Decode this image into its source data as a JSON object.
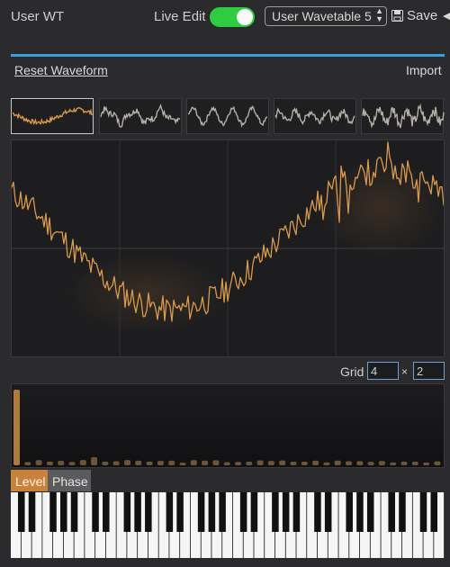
{
  "header": {
    "title": "User WT",
    "live_edit_label": "Live Edit",
    "live_edit_on": true,
    "preset_value": "User Wavetable 5",
    "save_label": "Save"
  },
  "actions": {
    "reset_label": "Reset Waveform",
    "import_label": "Import"
  },
  "grid": {
    "label": "Grid",
    "cols": "4",
    "times": "×",
    "rows": "2"
  },
  "tabs": {
    "level": "Level",
    "phase": "Phase"
  },
  "colors": {
    "accent": "#c8823c",
    "waveform": "#d99a4e",
    "toggle_on": "#2ecc40",
    "divider": "#3a9fd6",
    "thumb_wave": "#b5afa6"
  }
}
